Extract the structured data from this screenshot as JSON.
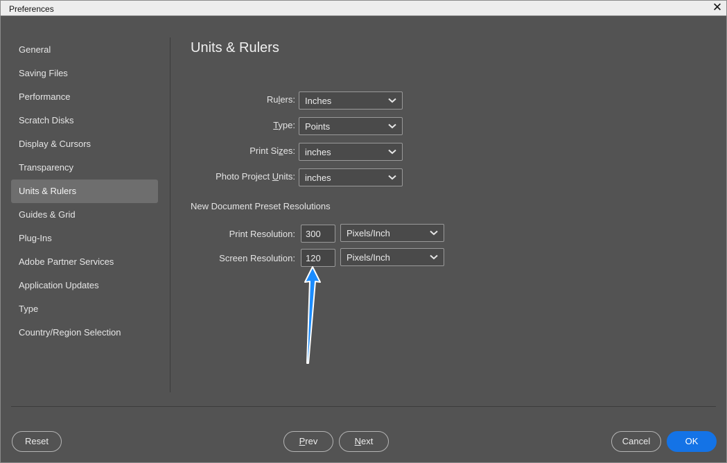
{
  "window": {
    "title": "Preferences"
  },
  "sidebar": {
    "items": [
      {
        "label": "General",
        "active": false
      },
      {
        "label": "Saving Files",
        "active": false
      },
      {
        "label": "Performance",
        "active": false
      },
      {
        "label": "Scratch Disks",
        "active": false
      },
      {
        "label": "Display & Cursors",
        "active": false
      },
      {
        "label": "Transparency",
        "active": false
      },
      {
        "label": "Units & Rulers",
        "active": true
      },
      {
        "label": "Guides & Grid",
        "active": false
      },
      {
        "label": "Plug-Ins",
        "active": false
      },
      {
        "label": "Adobe Partner Services",
        "active": false
      },
      {
        "label": "Application Updates",
        "active": false
      },
      {
        "label": "Type",
        "active": false
      },
      {
        "label": "Country/Region Selection",
        "active": false
      }
    ]
  },
  "main": {
    "title": "Units & Rulers",
    "units": {
      "rulers": {
        "label_pre": "Ru",
        "label_u": "l",
        "label_post": "ers:",
        "value": "Inches"
      },
      "type": {
        "label_pre": "",
        "label_u": "T",
        "label_post": "ype:",
        "value": "Points"
      },
      "print_sizes": {
        "label_pre": "Print Si",
        "label_u": "z",
        "label_post": "es:",
        "value": "inches"
      },
      "photo_project_units": {
        "label_pre": "Photo Project ",
        "label_u": "U",
        "label_post": "nits:",
        "value": "inches"
      }
    },
    "preset_section": {
      "heading": "New Document Preset Resolutions",
      "print_resolution": {
        "label": "Print Resolution:",
        "value": "300",
        "unit": "Pixels/Inch"
      },
      "screen_resolution": {
        "label": "Screen Resolution:",
        "value": "120",
        "unit": "Pixels/Inch"
      }
    }
  },
  "footer": {
    "reset": "Reset",
    "prev_u": "P",
    "prev_rest": "rev",
    "next_u": "N",
    "next_rest": "ext",
    "cancel": "Cancel",
    "ok": "OK"
  },
  "annotation": {
    "icon": "blue-arrow-pointer",
    "color": "#1a8cff"
  },
  "colors": {
    "accent": "#1473e6",
    "background": "#535353",
    "selected_item": "#6e6e6e"
  }
}
